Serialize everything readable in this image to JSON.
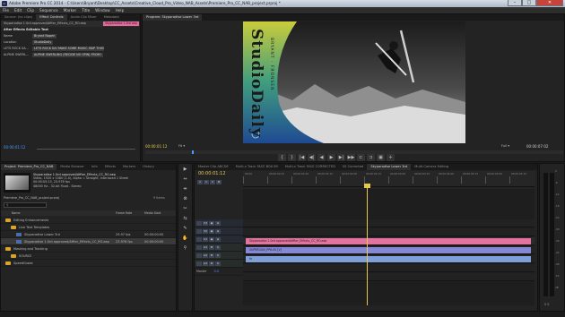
{
  "window": {
    "title": "Adobe Premiere Pro CC 2014 - C:\\Users\\Bryant\\Desktop\\CC_Assets\\Creative_Cloud_Pro_Video_NAB_Assets\\Premiere_Pro_CC_NAB_project.prproj *",
    "app_icon": "Pr",
    "minimize": "–",
    "maximize": "□",
    "close": "✕"
  },
  "menu": [
    "File",
    "Edit",
    "Clip",
    "Sequence",
    "Marker",
    "Title",
    "Window",
    "Help"
  ],
  "source_panel": {
    "tabs": [
      "Source: (no clips)",
      "Effect Controls",
      "Audio Clip Mixer",
      "Metadata"
    ],
    "active_tab": 1,
    "clip_path": "Skyparadise 1.0rd approved/Affter_Effects_CC_RO.aep",
    "chip": "Skyparadise 1.0rd aep",
    "section_title": "After Effects Editable Text",
    "rows": [
      {
        "label": "Name",
        "value": "Bryant Nopen"
      },
      {
        "label": "Location",
        "value": "StudioDaily"
      },
      {
        "label": "LETS ROCK SA...",
        "value": "LETS ROCK SA! MAKE SOME MUSIC SKIP THIS!"
      },
      {
        "label": "ALPINE SWERL...",
        "value": "ALPINE SWERLING (RECIDE NO SPIN) FROM!"
      }
    ],
    "timecode": "00:00:01:12"
  },
  "program_panel": {
    "tabs": [
      "Program: Skyparadise Lower 3rd"
    ],
    "timecode_left": "00:00:01:12",
    "fit": "Fit",
    "zoom": "Full",
    "timecode_right": "00:00:07:02",
    "overlay_text": "StudioDaily",
    "overlay_sub": "BRYANT · FRONSEN",
    "colors": {
      "gradient_top": "#c9cc3a",
      "gradient_mid": "#3f9d7e",
      "gradient_bottom": "#1f4a93",
      "sky": "#2a2a2a",
      "snow": "#d9d9d9"
    },
    "transport": [
      "{",
      "}",
      "|◀",
      "◀|",
      "◀",
      "▶",
      "▶|",
      "▶▶",
      "⊏",
      "⊐",
      "▣",
      "+"
    ]
  },
  "project_panel": {
    "tabs": [
      "Project: Premiere_Pro_CC_NAB",
      "Media Browser",
      "Info",
      "Effects",
      "Markers",
      "History"
    ],
    "active_tab": 0,
    "clip_name": "Skyparadise 1.0rd approved/Affter_Effects_CC_RO.aep",
    "clip_info": [
      "Video, 1920 x 1080 (1.0), Alpha = Straight, Interlaced 1 Sheet",
      "00:00:05:13, 23.976 fps",
      "48000 Hz - 32-bit Float - Stereo"
    ],
    "project_file": "Premiere_Pro_CC_NAB_project.prproj",
    "items_count": "9 Items",
    "search_placeholder": "⚲",
    "columns": [
      "Name",
      "Frame Rate",
      "Media Start"
    ],
    "rows": [
      {
        "icon": "folder",
        "name": "Editing Enhancements",
        "rate": "",
        "start": "",
        "indent": 0
      },
      {
        "icon": "folder",
        "name": "Live Text Templates",
        "rate": "",
        "start": "",
        "indent": 1
      },
      {
        "icon": "sequence",
        "name": "Skyparadise Lower 3rd",
        "rate": "29.97 fps",
        "start": "00:00:00:00",
        "indent": 2
      },
      {
        "icon": "sequence",
        "name": "Skyparadise 1.0rd approved/Affter_Effects_CC_RO.aep",
        "rate": "23.976 fps",
        "start": "00:00:00:00",
        "indent": 2
      },
      {
        "icon": "folder",
        "name": "Masking and Tracking",
        "rate": "",
        "start": "",
        "indent": 0
      },
      {
        "icon": "folder",
        "name": "SOURCE",
        "rate": "",
        "start": "",
        "indent": 1
      },
      {
        "icon": "folder",
        "name": "SpeedGrade",
        "rate": "",
        "start": "",
        "indent": 0
      }
    ]
  },
  "tools": [
    "▶",
    "⇔",
    "⇹",
    "⊗",
    "✂",
    "⇆",
    "✎",
    "✋",
    "⚲"
  ],
  "timeline": {
    "tabs": [
      "Master Clip ABCDE",
      "Multi-v Track FACE BOX 89",
      "Multi-v Track FACE CORRECTED",
      "SS Corrected",
      "Skyparadise Lower 3rd",
      "Multi-Camera Editing"
    ],
    "active_tab": 4,
    "timecode": "00:00:01:12",
    "ruler": [
      "00:00",
      "00:00:00:15",
      "00:00:01:00",
      "00:00:01:15",
      "00:00:02:00",
      "00:00:02:15",
      "00:00:03:00",
      "00:00:03:15",
      "00:00:04:00",
      "00:00:04:15",
      "00:00:05:00",
      "00:00:05:15"
    ],
    "tracks": [
      "V3",
      "V2",
      "V1",
      "A1",
      "A2",
      "A3",
      "Master"
    ],
    "master_value": "0.0",
    "clips": [
      {
        "track": 2,
        "label": "Skyparadise 1.0rd approved/Affter_Effects_CC_RO.aep",
        "color": "#e5739f"
      },
      {
        "track": 3,
        "label": "SUPERGUN_PP6.00 [V]",
        "color": "#8488d6"
      },
      {
        "track": 4,
        "label": "fx",
        "color": "#7f9fd9"
      }
    ]
  },
  "audio_meter": {
    "labels": [
      "0",
      "-6",
      "-12",
      "-18",
      "-24",
      "-30",
      "-36",
      "-42",
      "-48",
      "-54",
      "dB"
    ],
    "footer": "S S"
  }
}
